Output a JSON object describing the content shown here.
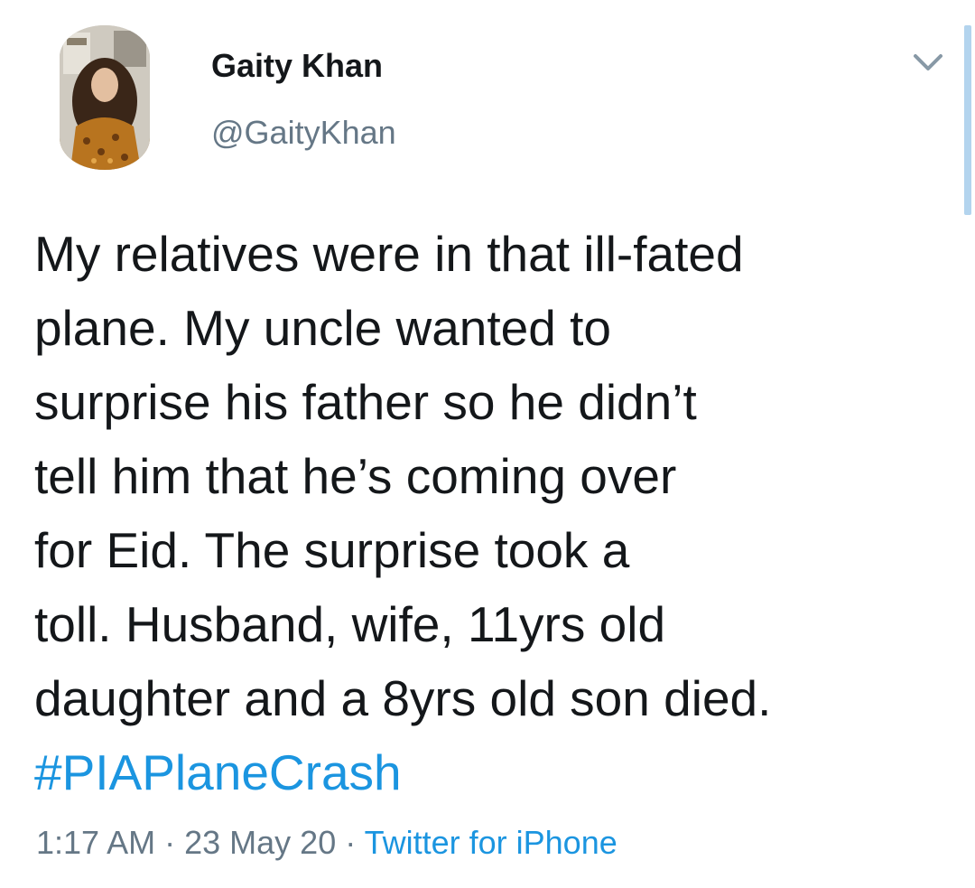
{
  "user": {
    "display_name": "Gaity Khan",
    "handle": "@GaityKhan"
  },
  "tweet": {
    "lines": [
      "My relatives were in that ill-fated",
      "plane. My uncle wanted to",
      "surprise his father so he didn’t",
      "tell him that he’s coming over",
      "for Eid. The surprise took a",
      "toll. Husband, wife, 11yrs old",
      "daughter and a 8yrs old son died."
    ],
    "hashtag": "#PIAPlaneCrash",
    "time": "1:17 AM",
    "separator": "·",
    "date": "23 May 20",
    "source": "Twitter for iPhone"
  },
  "icons": {
    "menu": "chevron-down-icon",
    "avatar": "profile-photo"
  },
  "colors": {
    "text": "#14171a",
    "secondary": "#657786",
    "link": "#1b95e0",
    "scroll_indicator": "#b3d4ee"
  }
}
